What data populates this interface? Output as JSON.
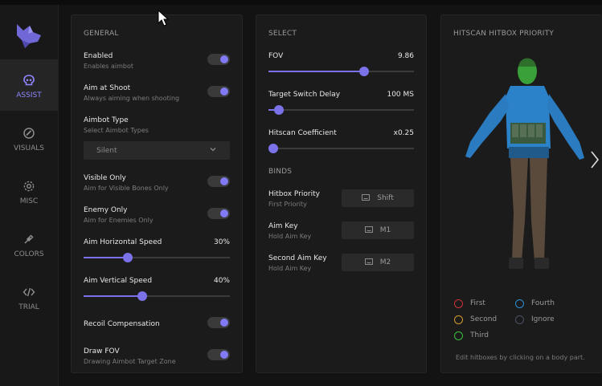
{
  "colors": {
    "accent": "#7b72ea",
    "panel": "#1b1b1b",
    "background": "#131313"
  },
  "sidebar": {
    "items": [
      {
        "label": "ASSIST",
        "icon": "skull-icon",
        "active": true
      },
      {
        "label": "VISUALS",
        "icon": "eye-icon",
        "active": false
      },
      {
        "label": "MISC",
        "icon": "gear-icon",
        "active": false
      },
      {
        "label": "COLORS",
        "icon": "eyedropper-icon",
        "active": false
      },
      {
        "label": "TRIAL",
        "icon": "code-icon",
        "active": false
      }
    ]
  },
  "general": {
    "title": "GENERAL",
    "enabled": {
      "label": "Enabled",
      "sub": "Enables aimbot",
      "on": true
    },
    "aim_at_shoot": {
      "label": "Aim at Shoot",
      "sub": "Always aiming when shooting",
      "on": true
    },
    "aimbot_type": {
      "label": "Aimbot Type",
      "sub": "Select Aimbot Types",
      "value": "Silent"
    },
    "visible_only": {
      "label": "Visible Only",
      "sub": "Aim for Visible Bones Only",
      "on": true
    },
    "enemy_only": {
      "label": "Enemy Only",
      "sub": "Aim for Enemies Only",
      "on": true
    },
    "aim_h_speed": {
      "label": "Aim Horizontal Speed",
      "value": "30%",
      "fraction": 0.3
    },
    "aim_v_speed": {
      "label": "Aim Vertical Speed",
      "value": "40%",
      "fraction": 0.4
    },
    "recoil": {
      "label": "Recoil Compensation",
      "on": true
    },
    "draw_fov": {
      "label": "Draw FOV",
      "sub": "Drawing Aimbot Target Zone",
      "on": true
    }
  },
  "select": {
    "title": "SELECT",
    "fov": {
      "label": "FOV",
      "value": "9.86",
      "fraction": 0.66
    },
    "switch_delay": {
      "label": "Target Switch Delay",
      "value": "100 MS",
      "fraction": 0.07
    },
    "hitscan": {
      "label": "Hitscan Coefficient",
      "value": "x0.25",
      "fraction": 0.0
    },
    "binds_title": "BINDS",
    "binds": [
      {
        "label": "Hitbox Priority",
        "sub": "First Priority",
        "key": "Shift"
      },
      {
        "label": "Aim Key",
        "sub": "Hold Aim Key",
        "key": "M1"
      },
      {
        "label": "Second Aim Key",
        "sub": "Hold Aim Key",
        "key": "M2"
      }
    ]
  },
  "hitbox": {
    "title": "HITSCAN HITBOX PRIORITY",
    "legend": [
      {
        "label": "First",
        "color": "#d0303a"
      },
      {
        "label": "Fourth",
        "color": "#2a8fd6"
      },
      {
        "label": "Second",
        "color": "#d59a2a"
      },
      {
        "label": "Ignore",
        "color": "#4a4f66"
      },
      {
        "label": "Third",
        "color": "#3bbf3b"
      }
    ],
    "hint": "Edit hitboxes by clicking on a body part."
  }
}
